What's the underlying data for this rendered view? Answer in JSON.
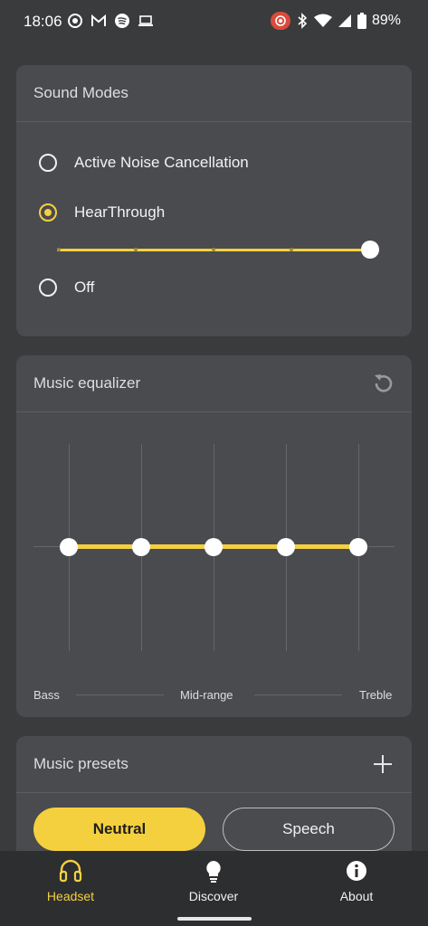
{
  "status_bar": {
    "time": "18:06",
    "battery_text": "89%",
    "left_icons": [
      "target-icon",
      "gmail-icon",
      "spotify-icon",
      "laptop-icon"
    ],
    "right_icons": [
      "screen-record-icon",
      "bluetooth-icon",
      "wifi-icon",
      "signal-icon",
      "battery-icon"
    ]
  },
  "sound_modes": {
    "title": "Sound Modes",
    "options": [
      {
        "label": "Active Noise Cancellation",
        "selected": false
      },
      {
        "label": "HearThrough",
        "selected": true
      },
      {
        "label": "Off",
        "selected": false
      }
    ],
    "hearthrough_level": 1.0
  },
  "equalizer": {
    "title": "Music equalizer",
    "bands": [
      0,
      0,
      0,
      0,
      0
    ],
    "labels": {
      "bass": "Bass",
      "mid": "Mid-range",
      "treble": "Treble"
    }
  },
  "presets": {
    "title": "Music presets",
    "items": [
      {
        "label": "Neutral",
        "selected": true
      },
      {
        "label": "Speech",
        "selected": false
      }
    ]
  },
  "bottom_nav": {
    "items": [
      {
        "label": "Headset",
        "icon": "headphones-icon",
        "active": true
      },
      {
        "label": "Discover",
        "icon": "lightbulb-icon",
        "active": false
      },
      {
        "label": "About",
        "icon": "info-icon",
        "active": false
      }
    ]
  },
  "colors": {
    "accent": "#f4d03f",
    "background": "#3a3b3d",
    "card": "#4a4b4f"
  }
}
